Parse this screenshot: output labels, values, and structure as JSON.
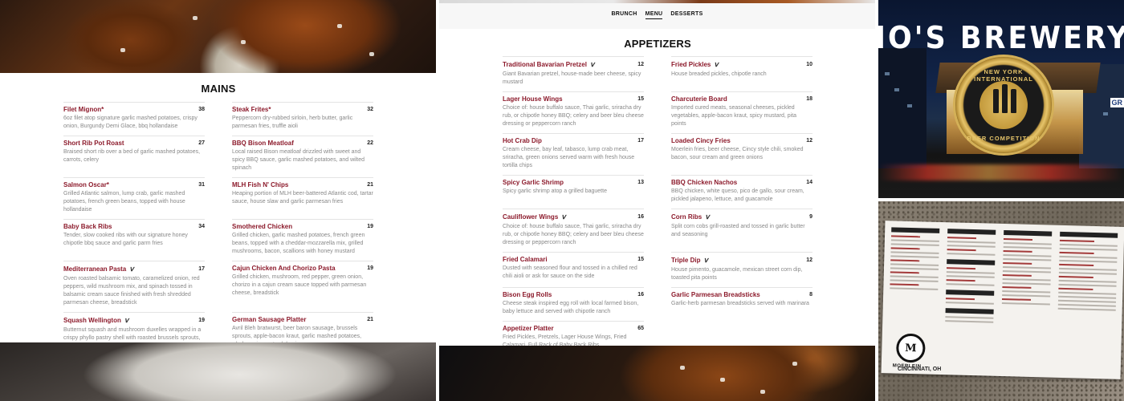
{
  "left": {
    "section_title": "MAINS",
    "items": [
      {
        "name": "Filet Mignon*",
        "veg": false,
        "price": "38",
        "desc": "6oz filet atop signature garlic mashed potatoes, crispy onion, Burgundy Demi Glace, bbq hollandaise"
      },
      {
        "name": "Steak Frites*",
        "veg": false,
        "price": "32",
        "desc": "Peppercorn dry-rubbed sirloin, herb butter, garlic parmesan fries, truffle aioli"
      },
      {
        "name": "Short Rib Pot Roast",
        "veg": false,
        "price": "27",
        "desc": "Braised short rib over a bed of garlic mashed potatoes, carrots, celery"
      },
      {
        "name": "BBQ Bison Meatloaf",
        "veg": false,
        "price": "22",
        "desc": "Local raised Bison meatloaf drizzled with sweet and spicy BBQ sauce, garlic mashed potatoes, and wilted spinach"
      },
      {
        "name": "Salmon Oscar*",
        "veg": false,
        "price": "31",
        "desc": "Grilled Atlantic salmon, lump crab, garlic mashed potatoes, french green beans, topped with house hollandaise"
      },
      {
        "name": "MLH Fish N' Chips",
        "veg": false,
        "price": "21",
        "desc": "Heaping portion of MLH beer-battered Atlantic cod, tartar sauce, house slaw and garlic parmesan fries"
      },
      {
        "name": "Baby Back Ribs",
        "veg": false,
        "price": "34",
        "desc": "Tender, slow cooked ribs with our signature honey chipotle bbq sauce and garlic parm fries"
      },
      {
        "name": "Smothered Chicken",
        "veg": false,
        "price": "19",
        "desc": "Grilled chicken, garlic mashed potatoes, french green beans, topped with a cheddar-mozzarella mix, grilled mushrooms, bacon, scallions with honey mustard"
      },
      {
        "name": "Mediterranean Pasta",
        "veg": true,
        "price": "17",
        "desc": "Oven roasted balsamic tomato, caramelized onion, red peppers, wild mushroom mix, and spinach tossed in balsamic cream sauce finished with fresh shredded parmesan cheese, breadstick"
      },
      {
        "name": "Cajun Chicken And Chorizo Pasta",
        "veg": false,
        "price": "19",
        "desc": "Grilled chicken, mushroom, red pepper, green onion, chorizo in a cajun cream sauce topped with parmesan cheese, breadstick"
      },
      {
        "name": "Squash Wellington",
        "veg": true,
        "price": "19",
        "desc": "Butternut squash and mushroom duxelles wrapped in a crispy phyllo pastry shell with roasted brussels sprouts, sweet corn cream, sweet tomato chutney"
      },
      {
        "name": "German Sausage Platter",
        "veg": false,
        "price": "21",
        "desc": "Avril Bleh bratwurst, beer baron sausage, brussels sprouts, apple-bacon kraut, garlic mashed potatoes, whole grain mustard demi"
      }
    ]
  },
  "mid": {
    "tabs": [
      {
        "label": "BRUNCH",
        "active": false
      },
      {
        "label": "MENU",
        "active": true
      },
      {
        "label": "DESSERTS",
        "active": false
      }
    ],
    "section_title": "APPETIZERS",
    "items": [
      {
        "name": "Traditional Bavarian Pretzel",
        "veg": true,
        "price": "12",
        "desc": "Giant Bavarian pretzel, house-made beer cheese, spicy mustard"
      },
      {
        "name": "Fried Pickles",
        "veg": true,
        "price": "10",
        "desc": "House breaded pickles, chipotle ranch"
      },
      {
        "name": "Lager House Wings",
        "veg": false,
        "price": "15",
        "desc": "Choice of: house buffalo sauce, Thai garlic, sriracha dry rub, or chipotle honey BBQ; celery and beer bleu cheese dressing or peppercorn ranch"
      },
      {
        "name": "Charcuterie Board",
        "veg": false,
        "price": "18",
        "desc": "Imported cured meats, seasonal cheeses, pickled vegetables, apple-bacon kraut, spicy mustard, pita points"
      },
      {
        "name": "Hot Crab Dip",
        "veg": false,
        "price": "17",
        "desc": "Cream cheese, bay leaf, tabasco, lump crab meat, sriracha, green onions served warm with fresh house tortilla chips"
      },
      {
        "name": "Loaded Cincy Fries",
        "veg": false,
        "price": "12",
        "desc": "Moerlein fries, beer cheese, Cincy style chili, smoked bacon, sour cream and green onions"
      },
      {
        "name": "Spicy Garlic Shrimp",
        "veg": false,
        "price": "13",
        "desc": "Spicy garlic shrimp atop a grilled baguette"
      },
      {
        "name": "BBQ Chicken Nachos",
        "veg": false,
        "price": "14",
        "desc": "BBQ chicken, white queso, pico de gallo, sour cream, pickled jalapeno, lettuce, and guacamole"
      },
      {
        "name": "Cauliflower Wings",
        "veg": true,
        "price": "16",
        "desc": "Choice of: house buffalo sauce, Thai garlic, sriracha dry rub, or chipotle honey BBQ; celery and beer bleu cheese dressing or peppercorn ranch"
      },
      {
        "name": "Corn Ribs",
        "veg": true,
        "price": "9",
        "desc": "Split corn cobs grill-roasted and tossed in garlic butter and seasoning"
      },
      {
        "name": "Fried Calamari",
        "veg": false,
        "price": "15",
        "desc": "Dusted with seasoned flour and tossed in a chilled red chili aioli or ask for sauce on the side"
      },
      {
        "name": "Triple Dip",
        "veg": true,
        "price": "12",
        "desc": "House pimento, guacamole, mexican street corn dip, toasted pita points"
      },
      {
        "name": "Bison Egg Rolls",
        "veg": false,
        "price": "16",
        "desc": "Cheese steak inspired egg roll with local farmed bison, baby lettuce and served with chipotle ranch"
      },
      {
        "name": "Garlic Parmesan Breadsticks",
        "veg": false,
        "price": "8",
        "desc": "Garlic-herb parmesan breadsticks served with marinara"
      },
      {
        "name": "Appetizer Platter",
        "veg": false,
        "price": "65",
        "desc": "Fried Pickles, Pretzels, Lager House Wings, Fried Calamari, Full Rack of Baby Back Ribs"
      }
    ]
  },
  "right_top": {
    "headline": "IO'S BREWERY OF THE YEA",
    "medal_top": "NEW YORK INTERNATIONAL",
    "medal_bottom": "BEER COMPETITION",
    "sign_fragment": "GR"
  },
  "right_bottom": {
    "logo_letter": "M",
    "brand": "MOERLEIN",
    "city": "CINCINNATI, OH"
  },
  "veg_icon": "vegan-v-icon",
  "colors": {
    "item_name": "#8c1a2b",
    "desc": "#888888",
    "gold": "#d4b057"
  }
}
